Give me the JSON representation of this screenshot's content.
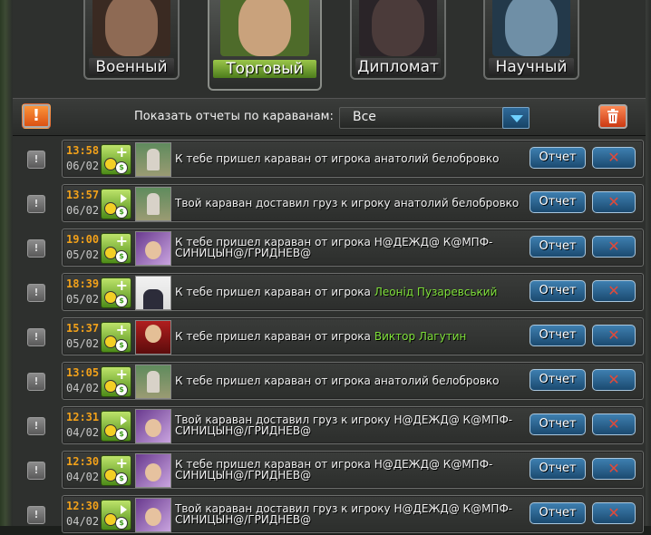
{
  "tabs": [
    {
      "label": "Военный",
      "active": false,
      "face_color": "#8e6a54"
    },
    {
      "label": "Торговый",
      "active": true,
      "face_color": "#c9a27c"
    },
    {
      "label": "Дипломат",
      "active": false,
      "face_color": "#4b3b3a"
    },
    {
      "label": "Научный",
      "active": false,
      "face_color": "#6f8fa6"
    }
  ],
  "filter": {
    "label": "Показать отчеты по караванам:",
    "selected": "Все",
    "warning_icon": "exclamation-icon",
    "trash_icon": "trash-icon"
  },
  "actions": {
    "report_label": "Отчет",
    "delete_glyph": "✕",
    "check_glyph": "!"
  },
  "rows": [
    {
      "time": "13:58",
      "date": "06/02",
      "icon": "plus",
      "avatar": "green",
      "text": "К тебе пришел караван от игрока анатолий белобровко",
      "player": ""
    },
    {
      "time": "13:57",
      "date": "06/02",
      "icon": "arrow",
      "avatar": "green",
      "text": "Твой караван доставил груз к игроку анатолий белобровко",
      "player": ""
    },
    {
      "time": "19:00",
      "date": "05/02",
      "icon": "plus",
      "avatar": "purple",
      "text": "К тебе пришел караван от игрока Н@ДЕЖД@ К@МПФ-СИНИЦЫН@/ГРИДНЕВ@",
      "player": ""
    },
    {
      "time": "18:39",
      "date": "05/02",
      "icon": "plus",
      "avatar": "suit",
      "text": "К тебе пришел караван от игрока",
      "player": "Леонід Пузаревський"
    },
    {
      "time": "15:37",
      "date": "05/02",
      "icon": "plus",
      "avatar": "red",
      "text": "К тебе пришел караван от игрока",
      "player": "Виктор Лагутин"
    },
    {
      "time": "13:05",
      "date": "04/02",
      "icon": "plus",
      "avatar": "green",
      "text": "К тебе пришел караван от игрока анатолий белобровко",
      "player": ""
    },
    {
      "time": "12:31",
      "date": "04/02",
      "icon": "arrow",
      "avatar": "purple",
      "text": "Твой караван доставил груз к игроку Н@ДЕЖД@ К@МПФ-СИНИЦЫН@/ГРИДНЕВ@",
      "player": ""
    },
    {
      "time": "12:30",
      "date": "04/02",
      "icon": "plus",
      "avatar": "purple",
      "text": "К тебе пришел караван от игрока Н@ДЕЖД@ К@МПФ-СИНИЦЫН@/ГРИДНЕВ@",
      "player": ""
    },
    {
      "time": "12:30",
      "date": "04/02",
      "icon": "arrow",
      "avatar": "purple",
      "text": "Твой караван доставил груз к игроку Н@ДЕЖД@ К@МПФ-СИНИЦЫН@/ГРИДНЕВ@",
      "player": ""
    }
  ],
  "colors": {
    "time": "#f2a11a",
    "player_link": "#7fe03a",
    "accent_blue": "#1b4a70",
    "active_tab": "#7aae30"
  }
}
